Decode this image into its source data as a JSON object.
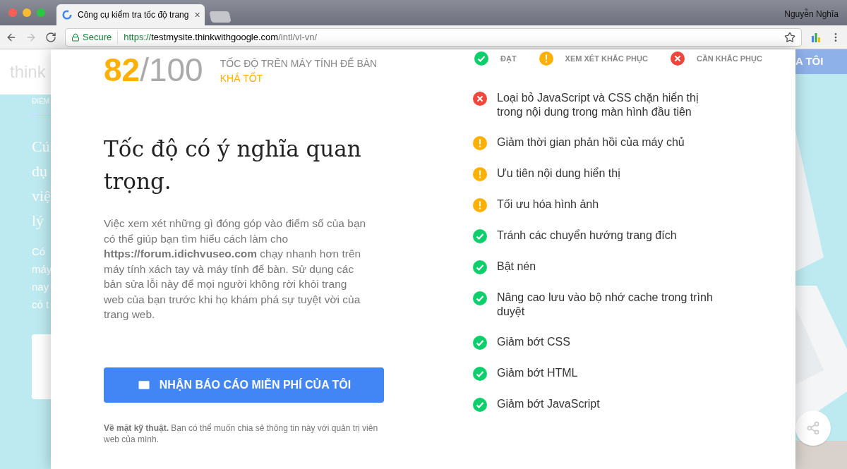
{
  "window": {
    "tab_title": "Công cụ kiểm tra tốc độ trang",
    "tab_close": "×",
    "user": "Nguyễn Nghĩa",
    "secure": "Secure",
    "url_scheme": "https://",
    "url_host": "testmysite.thinkwithgoogle.com",
    "url_path": "/intl/vi-vn/"
  },
  "background": {
    "logo": "think",
    "section_label": "ĐIỂM",
    "title_lines": [
      "Cú",
      "dụ",
      "việ",
      "lý"
    ],
    "body_lines": [
      "Có",
      "máy",
      "nay",
      "có t"
    ],
    "nav_link": "A TÔI"
  },
  "modal": {
    "score": "82",
    "score_total": "/100",
    "score_label": "TỐC ĐỘ TRÊN MÁY TÍNH ĐỂ BÀN",
    "rating": "KHÁ TỐT",
    "heading": "Tốc độ có ý nghĩa quan trọng.",
    "body": "Việc xem xét những gì đóng góp vào điểm số của bạn có thể giúp bạn tìm hiểu cách làm cho **https://forum.idichvuseo.com** chạy nhanh hơn trên máy tính xách tay và máy tính để bàn. Sử dụng các bản sửa lỗi này để mọi người không rời khỏi trang web của bạn trước khi họ khám phá sự tuyệt vời của trang web.",
    "button": "NHẬN BÁO CÁO MIỄN PHÍ CỦA TÔI",
    "note": "**Về mặt kỹ thuật.** Bạn có thể muốn chia sẻ thông tin này với quản trị viên web của mình.",
    "legend": [
      {
        "kind": "pass",
        "label": "ĐẠT"
      },
      {
        "kind": "consider",
        "label": "XEM XÉT KHẮC PHỤC"
      },
      {
        "kind": "fix",
        "label": "CẦN KHẮC PHỤC"
      }
    ],
    "checks": [
      {
        "kind": "fix",
        "label": "Loại bỏ JavaScript và CSS chặn hiển thị trong nội dung trong màn hình đầu tiên"
      },
      {
        "kind": "consider",
        "label": "Giảm thời gian phản hồi của máy chủ"
      },
      {
        "kind": "consider",
        "label": "Ưu tiên nội dung hiển thị"
      },
      {
        "kind": "consider",
        "label": "Tối ưu hóa hình ảnh"
      },
      {
        "kind": "pass",
        "label": "Tránh các chuyển hướng trang đích"
      },
      {
        "kind": "pass",
        "label": "Bật nén"
      },
      {
        "kind": "pass",
        "label": "Nâng cao lưu vào bộ nhớ cache trong trình duyệt"
      },
      {
        "kind": "pass",
        "label": "Giảm bớt CSS"
      },
      {
        "kind": "pass",
        "label": "Giảm bớt HTML"
      },
      {
        "kind": "pass",
        "label": "Giảm bớt JavaScript"
      }
    ]
  }
}
